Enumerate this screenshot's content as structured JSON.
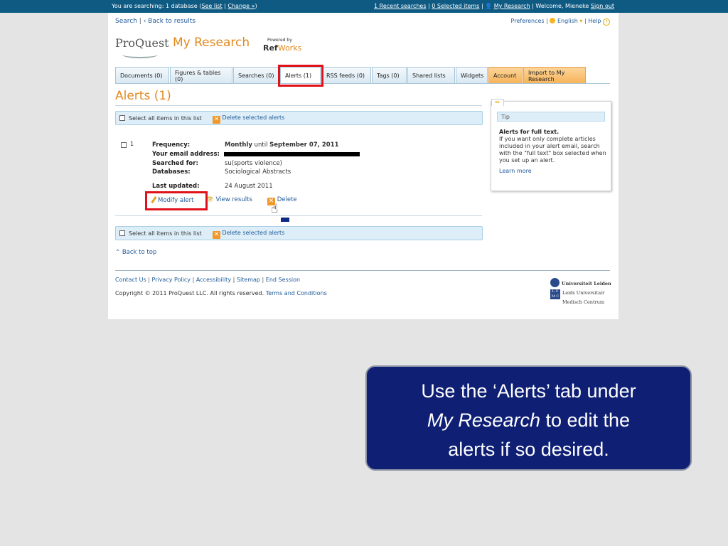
{
  "topbar": {
    "searching_prefix": "You are searching: 1 database (",
    "see_list": "See list",
    "separator": " | ",
    "change": "Change »",
    "suffix": ")",
    "recent_searches": "1 Recent searches",
    "selected_items": "0 Selected items",
    "my_research": "My Research",
    "welcome": "Welcome, Mieneke",
    "sign_out": "Sign out"
  },
  "nav": {
    "search": "Search",
    "back": "‹ Back to results",
    "preferences": "Preferences",
    "language": "English",
    "help": "Help"
  },
  "logo": {
    "proquest": "ProQuest",
    "my_research": "My Research",
    "powered_by": "Powered by",
    "ref": "Ref",
    "works": "Works"
  },
  "tabs": [
    {
      "label": "Documents (0)"
    },
    {
      "label": "Figures & tables (0)"
    },
    {
      "label": "Searches (0)"
    },
    {
      "label": "Alerts (1)"
    },
    {
      "label": "RSS feeds (0)"
    },
    {
      "label": "Tags (0)"
    },
    {
      "label": "Shared lists"
    },
    {
      "label": "Widgets"
    },
    {
      "label": "Account"
    },
    {
      "label": "Import to My Research"
    }
  ],
  "page_title": "Alerts (1)",
  "select_bar": {
    "select_all": "Select all items in this list",
    "delete_selected": "Delete selected alerts"
  },
  "alert": {
    "number": "1",
    "frequency_label": "Frequency:",
    "frequency_value": "Monthly",
    "until_word": "until",
    "until_date": "September 07, 2011",
    "email_label": "Your email address:",
    "searched_label": "Searched for:",
    "searched_value": "su(sports violence)",
    "databases_label": "Databases:",
    "databases_value": "Sociological Abstracts",
    "updated_label": "Last updated:",
    "updated_value": "24 August 2011",
    "modify": "Modify alert",
    "view": "View results",
    "delete": "Delete"
  },
  "back_to_top": "Back to top",
  "footer": {
    "contact": "Contact Us",
    "privacy": "Privacy Policy",
    "accessibility": "Accessibility",
    "sitemap": "Sitemap",
    "end_session": "End Session",
    "copyright": "Copyright © 2011 ProQuest LLC. All rights reserved.",
    "terms": "Terms and Conditions",
    "universiteit": "Universiteit Leiden",
    "lumc1": "Leids Universitair",
    "lumc2": "Medisch Centrum"
  },
  "tip": {
    "heading": "Tip",
    "title": "Alerts for full text.",
    "body": "If you want only complete articles included in your alert email, search with the \"full text\" box selected when you set up an alert.",
    "learn_more": "Learn more"
  },
  "callout": {
    "line1": "Use the ‘Alerts’ tab under",
    "em": "My Research",
    "line2": "to edit the",
    "line3": "alerts if so desired."
  },
  "colors": {
    "topbar": "#0e5a82",
    "accent_orange": "#e08a1e",
    "highlight_red": "#e0111a",
    "callout_bg": "#0e1f74"
  }
}
